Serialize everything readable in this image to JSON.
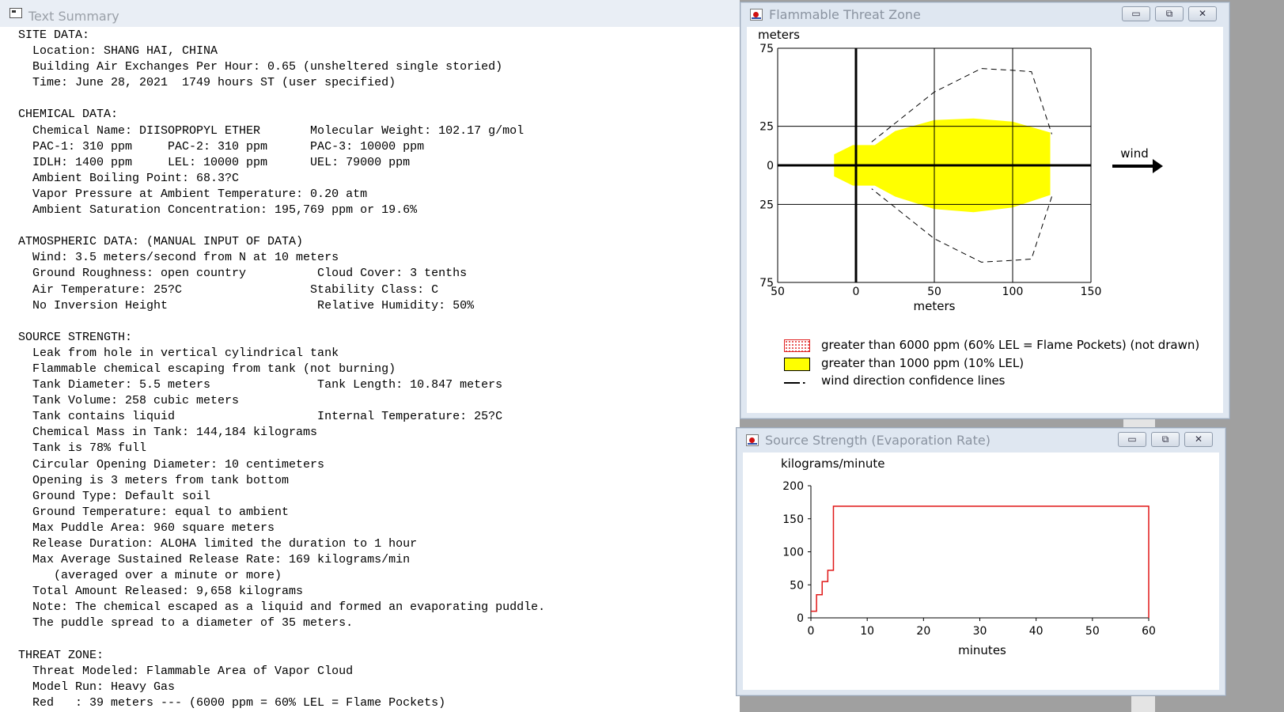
{
  "text_summary": {
    "title": "Text Summary",
    "lines": [
      "SITE DATA:",
      "  Location: SHANG HAI, CHINA",
      "  Building Air Exchanges Per Hour: 0.65 (unsheltered single storied)",
      "  Time: June 28, 2021  1749 hours ST (user specified)",
      "",
      "CHEMICAL DATA:",
      "  Chemical Name: DIISOPROPYL ETHER       Molecular Weight: 102.17 g/mol",
      "  PAC-1: 310 ppm     PAC-2: 310 ppm      PAC-3: 10000 ppm",
      "  IDLH: 1400 ppm     LEL: 10000 ppm      UEL: 79000 ppm",
      "  Ambient Boiling Point: 68.3?C",
      "  Vapor Pressure at Ambient Temperature: 0.20 atm",
      "  Ambient Saturation Concentration: 195,769 ppm or 19.6%",
      "",
      "ATMOSPHERIC DATA: (MANUAL INPUT OF DATA)",
      "  Wind: 3.5 meters/second from N at 10 meters",
      "  Ground Roughness: open country          Cloud Cover: 3 tenths",
      "  Air Temperature: 25?C                  Stability Class: C",
      "  No Inversion Height                     Relative Humidity: 50%",
      "",
      "SOURCE STRENGTH:",
      "  Leak from hole in vertical cylindrical tank",
      "  Flammable chemical escaping from tank (not burning)",
      "  Tank Diameter: 5.5 meters               Tank Length: 10.847 meters",
      "  Tank Volume: 258 cubic meters",
      "  Tank contains liquid                    Internal Temperature: 25?C",
      "  Chemical Mass in Tank: 144,184 kilograms",
      "  Tank is 78% full",
      "  Circular Opening Diameter: 10 centimeters",
      "  Opening is 3 meters from tank bottom",
      "  Ground Type: Default soil",
      "  Ground Temperature: equal to ambient",
      "  Max Puddle Area: 960 square meters",
      "  Release Duration: ALOHA limited the duration to 1 hour",
      "  Max Average Sustained Release Rate: 169 kilograms/min",
      "     (averaged over a minute or more)",
      "  Total Amount Released: 9,658 kilograms",
      "  Note: The chemical escaped as a liquid and formed an evaporating puddle.",
      "  The puddle spread to a diameter of 35 meters.",
      "",
      "THREAT ZONE:",
      "  Threat Modeled: Flammable Area of Vapor Cloud",
      "  Model Run: Heavy Gas",
      "  Red   : 39 meters --- (6000 ppm = 60% LEL = Flame Pockets)"
    ]
  },
  "threat_zone_window": {
    "title": "Flammable Threat Zone",
    "buttons": {
      "minimize": "▭",
      "maximize": "⧉",
      "close": "✕"
    },
    "wind_label": "wind",
    "legend": [
      {
        "label": "greater than 6000 ppm (60% LEL = Flame Pockets) (not drawn)",
        "style": "red-dotted"
      },
      {
        "label": "greater than 1000 ppm (10% LEL)",
        "style": "yellow"
      },
      {
        "label": "wind direction confidence lines",
        "style": "dashed"
      }
    ],
    "colors": {
      "zone_yellow": "#ffff00",
      "flame_red": "#e02020"
    }
  },
  "source_window": {
    "title": "Source Strength (Evaporation Rate)",
    "buttons": {
      "minimize": "▭",
      "maximize": "⧉",
      "close": "✕"
    },
    "colors": {
      "line": "#e01818"
    }
  },
  "chart_data": [
    {
      "type": "area",
      "xlabel": "meters",
      "ylabel": "meters",
      "xlim": [
        -50,
        150
      ],
      "ylim": [
        -75,
        75
      ],
      "x_ticks": [
        50,
        0,
        50,
        100,
        150
      ],
      "y_ticks": [
        75,
        25,
        0,
        25,
        75
      ],
      "grid": true,
      "series": [
        {
          "name": "greater than 1000 ppm (10% LEL)",
          "x": [
            -2,
            0,
            12,
            25,
            50,
            75,
            100,
            124,
            124,
            100,
            75,
            50,
            25,
            12,
            0,
            -2,
            -14,
            -14
          ],
          "y": [
            13,
            13,
            13,
            22,
            29,
            30,
            28,
            21,
            -19,
            -27,
            -30,
            -28,
            -20,
            -13,
            -13,
            -13,
            -7,
            7
          ]
        },
        {
          "name": "wind direction confidence lines",
          "x": [
            10,
            50,
            80,
            98,
            112,
            125,
            125,
            112,
            98,
            80,
            50,
            10
          ],
          "y": [
            15,
            47,
            62,
            61,
            60,
            20,
            -20,
            -60,
            -61,
            -62,
            -47,
            -15
          ]
        }
      ]
    },
    {
      "type": "line",
      "xlabel": "minutes",
      "ylabel": "kilograms/minute",
      "xlim": [
        0,
        60
      ],
      "ylim": [
        0,
        200
      ],
      "x_ticks": [
        0,
        10,
        20,
        30,
        40,
        50,
        60
      ],
      "y_ticks": [
        0,
        50,
        100,
        150,
        200
      ],
      "series": [
        {
          "name": "evaporation rate",
          "x": [
            0,
            1,
            1,
            2,
            2,
            3,
            3,
            4,
            4,
            60,
            60
          ],
          "y": [
            10,
            10,
            35,
            35,
            55,
            55,
            72,
            72,
            169,
            169,
            0
          ]
        }
      ]
    }
  ]
}
